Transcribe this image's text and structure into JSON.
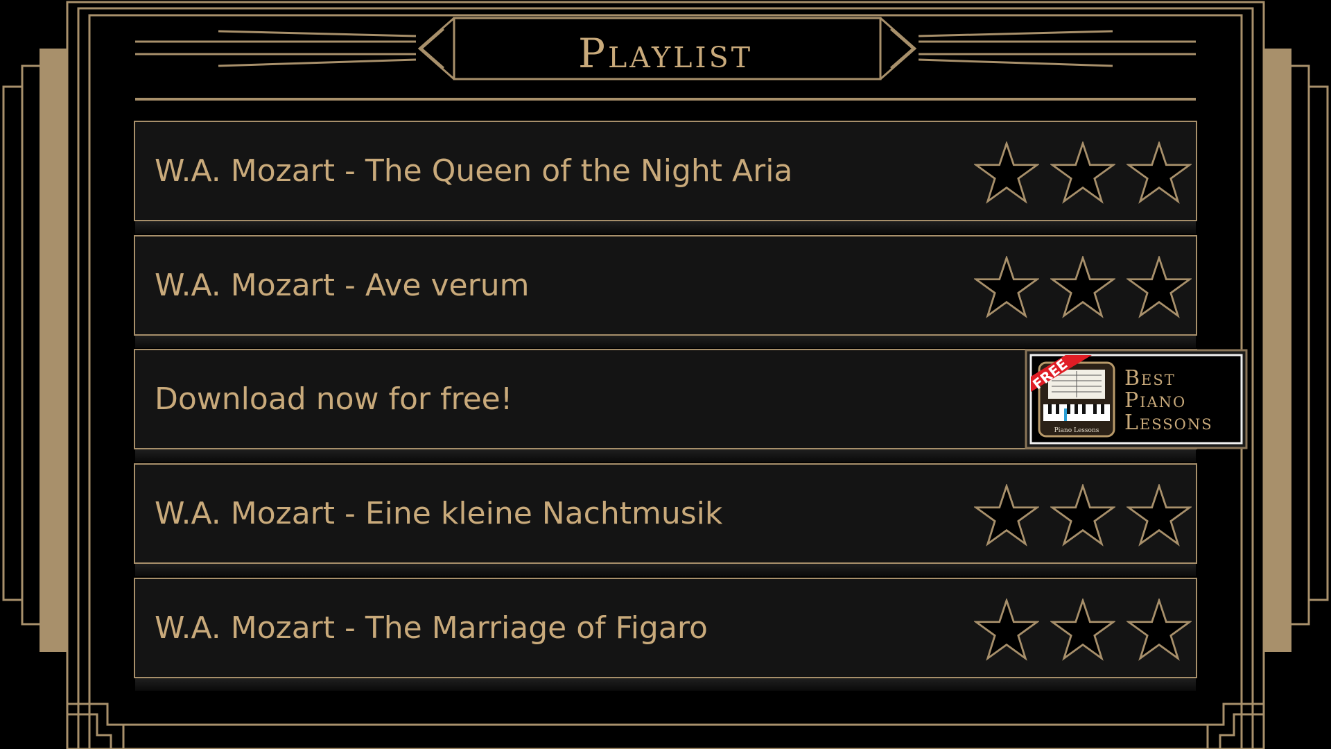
{
  "title": "Playlist",
  "colors": {
    "gold": "#c9aa7b",
    "frame_gold": "#a8906b",
    "row_bg": "#141414",
    "background": "#000000"
  },
  "playlist": [
    {
      "label": "W.A. Mozart - The Queen of the Night Aria",
      "stars": 3,
      "max_stars": 3,
      "stars_earned": 0
    },
    {
      "label": "W.A. Mozart - Ave verum",
      "stars": 3,
      "max_stars": 3,
      "stars_earned": 0
    },
    {
      "label": "Download now for free!",
      "ad": true
    },
    {
      "label": "W.A. Mozart - Eine kleine Nachtmusik",
      "stars": 3,
      "max_stars": 3,
      "stars_earned": 0
    },
    {
      "label": "W.A. Mozart - The Marriage of Figaro",
      "stars": 3,
      "max_stars": 3,
      "stars_earned": 0
    }
  ],
  "promo": {
    "badge": "FREE",
    "title_lines": [
      "Best",
      "Piano",
      "Lessons"
    ],
    "icon_caption": "Piano Lessons",
    "icon": "piano-app-icon"
  }
}
